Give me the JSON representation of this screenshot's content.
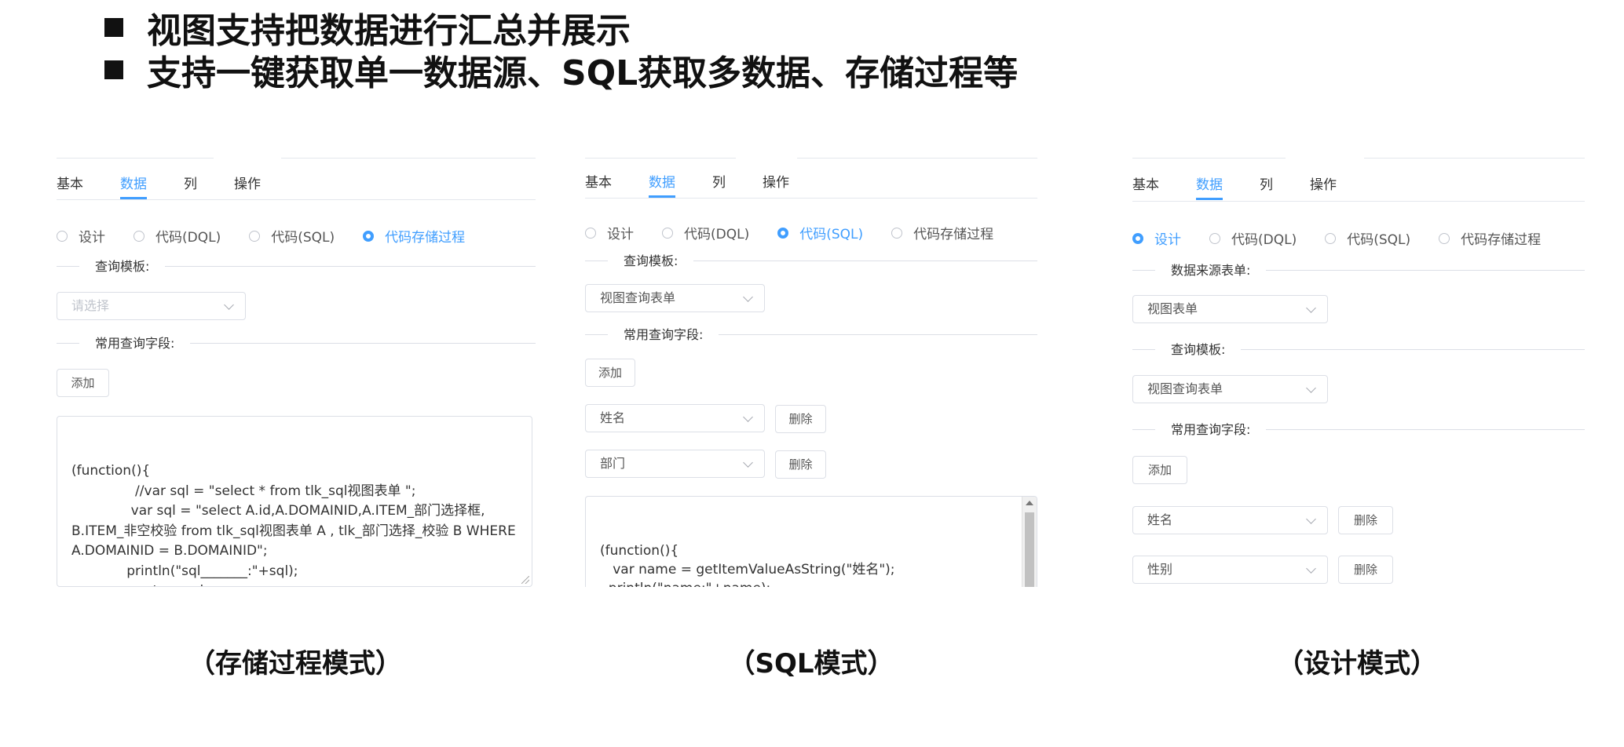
{
  "bullets": [
    "视图支持把数据进行汇总并展示",
    "支持一键获取单一数据源、SQL获取多数据、存储过程等"
  ],
  "accent_color": "#409eff",
  "panels": {
    "procedure": {
      "tabs": [
        "基本",
        "数据",
        "列",
        "操作"
      ],
      "radios": [
        "设计",
        "代码(DQL)",
        "代码(SQL)",
        "代码存储过程"
      ],
      "label_template": "查询模板:",
      "template_placeholder": "请选择",
      "label_fields": "常用查询字段:",
      "add_label": "添加",
      "code": "(function(){\n               //var sql = \"select * from tlk_sql视图表单 \";\n              var sql = \"select A.id,A.DOMAINID,A.ITEM_部门选择框,\nB.ITEM_非空校验 from tlk_sql视图表单 A , tlk_部门选择_校验 B WHERE\nA.DOMAINID = B.DOMAINID\";\n             println(\"sql_______:\"+sql);\n                return sql;\n               })()",
      "caption": "（存储过程模式）"
    },
    "sql": {
      "tabs": [
        "基本",
        "数据",
        "列",
        "操作"
      ],
      "radios": [
        "设计",
        "代码(DQL)",
        "代码(SQL)",
        "代码存储过程"
      ],
      "label_template": "查询模板:",
      "template_value": "视图查询表单",
      "label_fields": "常用查询字段:",
      "add_label": "添加",
      "field1": "姓名",
      "field2": "部门",
      "delete_label": "删除",
      "code": "(function(){\n   var name = getItemValueAsString(\"姓名\");\n  println(\"name:\"+name);\n   var bumen = getItemValueAsString(\"部门\");\n  println(\"bumen:\"+bumen);",
      "caption": "（SQL模式）"
    },
    "design": {
      "tabs": [
        "基本",
        "数据",
        "列",
        "操作"
      ],
      "radios": [
        "设计",
        "代码(DQL)",
        "代码(SQL)",
        "代码存储过程"
      ],
      "label_source": "数据来源表单:",
      "source_value": "视图表单",
      "label_template": "查询模板:",
      "template_value": "视图查询表单",
      "label_fields": "常用查询字段:",
      "add_label": "添加",
      "field1": "姓名",
      "field2": "性别",
      "delete_label": "删除",
      "caption": "（设计模式）"
    }
  }
}
